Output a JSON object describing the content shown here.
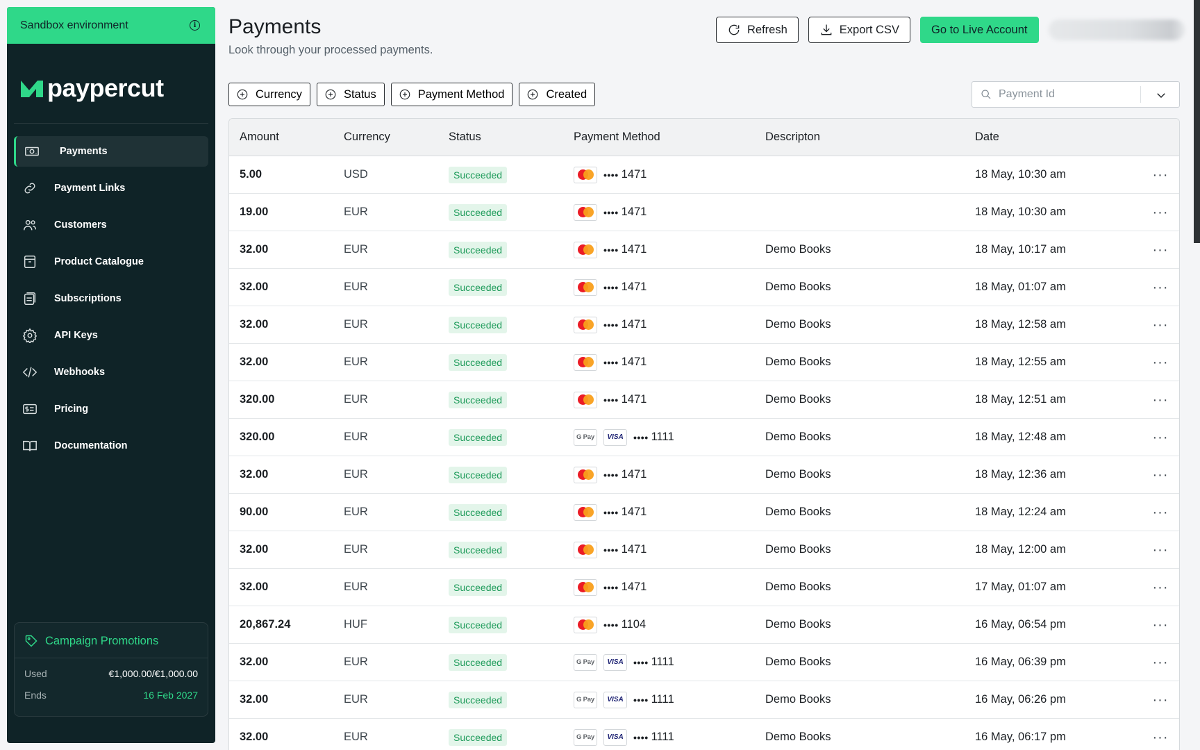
{
  "sidebar": {
    "sandbox_label": "Sandbox environment",
    "logo_text": "paypercut",
    "items": [
      {
        "label": "Payments",
        "icon": "banknote-icon",
        "active": true
      },
      {
        "label": "Payment Links",
        "icon": "link-icon"
      },
      {
        "label": "Customers",
        "icon": "users-icon"
      },
      {
        "label": "Product Catalogue",
        "icon": "box-icon"
      },
      {
        "label": "Subscriptions",
        "icon": "subscriptions-icon"
      },
      {
        "label": "API Keys",
        "icon": "gear-icon"
      },
      {
        "label": "Webhooks",
        "icon": "code-icon"
      },
      {
        "label": "Pricing",
        "icon": "pricing-icon"
      },
      {
        "label": "Documentation",
        "icon": "book-icon"
      }
    ],
    "promo": {
      "title": "Campaign Promotions",
      "used_label": "Used",
      "used_value": "€1,000.00/€1,000.00",
      "ends_label": "Ends",
      "ends_value": "16 Feb 2027"
    }
  },
  "header": {
    "title": "Payments",
    "subtitle": "Look through your processed payments.",
    "refresh_label": "Refresh",
    "export_label": "Export CSV",
    "live_label": "Go to Live Account"
  },
  "filters": [
    "Currency",
    "Status",
    "Payment Method",
    "Created"
  ],
  "search": {
    "placeholder": "Payment Id"
  },
  "table": {
    "columns": [
      "Amount",
      "Currency",
      "Status",
      "Payment Method",
      "Descripton",
      "Date"
    ],
    "rows": [
      {
        "amount": "5.00",
        "currency": "USD",
        "status": "Succeeded",
        "method": "mastercard",
        "last4": "1471",
        "description": "",
        "date": "18 May, 10:30 am"
      },
      {
        "amount": "19.00",
        "currency": "EUR",
        "status": "Succeeded",
        "method": "mastercard",
        "last4": "1471",
        "description": "",
        "date": "18 May, 10:30 am"
      },
      {
        "amount": "32.00",
        "currency": "EUR",
        "status": "Succeeded",
        "method": "mastercard",
        "last4": "1471",
        "description": "Demo Books",
        "date": "18 May, 10:17 am"
      },
      {
        "amount": "32.00",
        "currency": "EUR",
        "status": "Succeeded",
        "method": "mastercard",
        "last4": "1471",
        "description": "Demo Books",
        "date": "18 May, 01:07 am"
      },
      {
        "amount": "32.00",
        "currency": "EUR",
        "status": "Succeeded",
        "method": "mastercard",
        "last4": "1471",
        "description": "Demo Books",
        "date": "18 May, 12:58 am"
      },
      {
        "amount": "32.00",
        "currency": "EUR",
        "status": "Succeeded",
        "method": "mastercard",
        "last4": "1471",
        "description": "Demo Books",
        "date": "18 May, 12:55 am"
      },
      {
        "amount": "320.00",
        "currency": "EUR",
        "status": "Succeeded",
        "method": "mastercard",
        "last4": "1471",
        "description": "Demo Books",
        "date": "18 May, 12:51 am"
      },
      {
        "amount": "320.00",
        "currency": "EUR",
        "status": "Succeeded",
        "method": "gpay-visa",
        "last4": "1111",
        "description": "Demo Books",
        "date": "18 May, 12:48 am"
      },
      {
        "amount": "32.00",
        "currency": "EUR",
        "status": "Succeeded",
        "method": "mastercard",
        "last4": "1471",
        "description": "Demo Books",
        "date": "18 May, 12:36 am"
      },
      {
        "amount": "90.00",
        "currency": "EUR",
        "status": "Succeeded",
        "method": "mastercard",
        "last4": "1471",
        "description": "Demo Books",
        "date": "18 May, 12:24 am"
      },
      {
        "amount": "32.00",
        "currency": "EUR",
        "status": "Succeeded",
        "method": "mastercard",
        "last4": "1471",
        "description": "Demo Books",
        "date": "18 May, 12:00 am"
      },
      {
        "amount": "32.00",
        "currency": "EUR",
        "status": "Succeeded",
        "method": "mastercard",
        "last4": "1471",
        "description": "Demo Books",
        "date": "17 May, 01:07 am"
      },
      {
        "amount": "20,867.24",
        "currency": "HUF",
        "status": "Succeeded",
        "method": "mastercard",
        "last4": "1104",
        "description": "Demo Books",
        "date": "16 May, 06:54 pm"
      },
      {
        "amount": "32.00",
        "currency": "EUR",
        "status": "Succeeded",
        "method": "gpay-visa",
        "last4": "1111",
        "description": "Demo Books",
        "date": "16 May, 06:39 pm"
      },
      {
        "amount": "32.00",
        "currency": "EUR",
        "status": "Succeeded",
        "method": "gpay-visa",
        "last4": "1111",
        "description": "Demo Books",
        "date": "16 May, 06:26 pm"
      },
      {
        "amount": "32.00",
        "currency": "EUR",
        "status": "Succeeded",
        "method": "gpay-visa",
        "last4": "1111",
        "description": "Demo Books",
        "date": "16 May, 06:17 pm"
      }
    ],
    "dots_text": "••••",
    "gpay_text": "G Pay",
    "visa_text": "VISA",
    "more_text": "···"
  },
  "colors": {
    "accent": "#2fd889",
    "sidebar_bg": "#0f2327",
    "badge_bg": "#e3f5ea",
    "badge_text": "#1e9b5a"
  }
}
